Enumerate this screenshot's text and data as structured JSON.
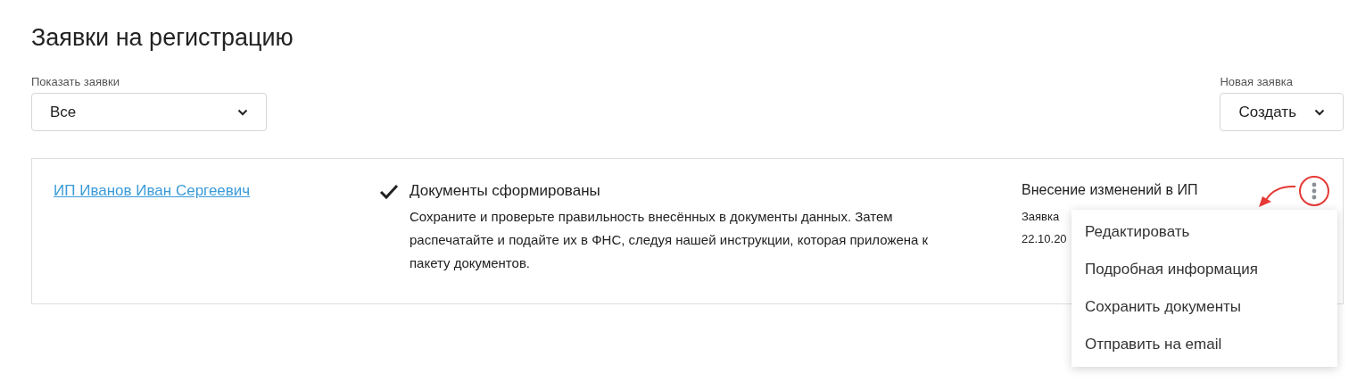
{
  "title": "Заявки на регистрацию",
  "filter": {
    "label": "Показать заявки",
    "value": "Все"
  },
  "create": {
    "label": "Новая заявка",
    "value": "Создать"
  },
  "applications": [
    {
      "name": "ИП Иванов Иван Сергеевич",
      "status": {
        "done": true,
        "title": "Документы сформированы",
        "text": "Сохраните и проверьте правильность внесённых в документы данных. Затем распечатайте и подайте их в ФНС, следуя нашей инструкции, которая приложена к пакету документов."
      },
      "type": "Внесение изменений в ИП",
      "number": "Заявка",
      "date": "22.10.20"
    }
  ],
  "menu": {
    "items": [
      "Редактировать",
      "Подробная информация",
      "Сохранить документы",
      "Отправить на email"
    ]
  }
}
